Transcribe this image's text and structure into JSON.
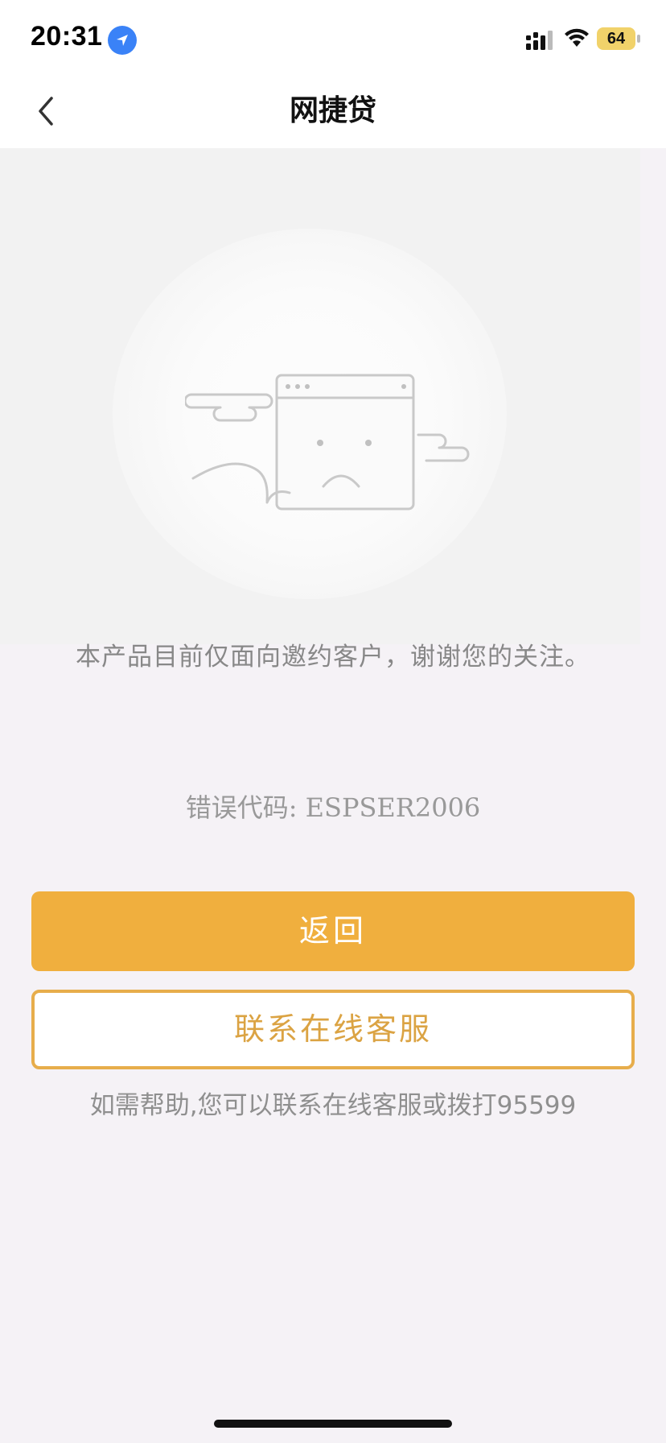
{
  "status_bar": {
    "time": "20:31",
    "battery": "64"
  },
  "nav": {
    "title": "网捷贷"
  },
  "content": {
    "message": "本产品目前仅面向邀约客户，谢谢您的关注。",
    "error_code": "错误代码: ESPSER2006",
    "primary_button": "返回",
    "secondary_button": "联系在线客服",
    "help_text": "如需帮助,您可以联系在线客服或拨打95599"
  },
  "icons": {
    "location": "location-arrow-icon",
    "signal": "cellular-signal-icon",
    "wifi": "wifi-icon",
    "battery": "battery-charging-icon",
    "back": "chevron-left-icon",
    "illustration": "sad-browser-window-illustration"
  },
  "colors": {
    "accent": "#f0af3e",
    "secondary_border": "#e7ad4b",
    "location_blue": "#3a82f7"
  }
}
